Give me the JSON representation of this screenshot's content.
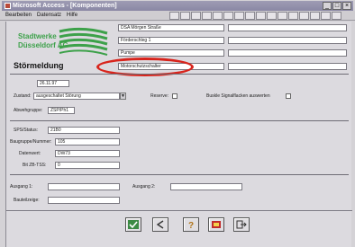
{
  "window": {
    "title": "Microsoft Access - [Komponenten]",
    "controls": [
      "_",
      "□",
      "×"
    ]
  },
  "menu": {
    "items": [
      "Bearbeiten",
      "Datensatz",
      "Hilfe"
    ]
  },
  "logo": {
    "line1": "Stadtwerke",
    "line2": "Düsseldorf AG"
  },
  "address": {
    "line1": "DSA Mörgen Straße",
    "line2": "Förderschleg 1",
    "line3": "Pumpe",
    "line4": "Motorschutzschalter"
  },
  "heading": "Störmeldung",
  "date_value": "26.11.97",
  "fields": {
    "zustand_label": "Zustand:",
    "zustand_value": "ausgeschaltet Störung",
    "reserve_label": "Reserve:",
    "signal_label": "Buskle Signalflacken auswerten",
    "abwgruppe_label": "Abwehgruppe:",
    "abwgruppe_value": "ZSP/Ph1",
    "sps_label": "SPS/Status:",
    "sps_value": "21B0",
    "baugruppe_label": "Baugruppe/Nummer:",
    "baugruppe_value": "105",
    "datenwert_label": "Datenwert:",
    "datenwert_value": "DW73",
    "bitzeile_label": "Bit ZB-TSS:",
    "bitzeile_value": "0"
  },
  "bottom_fields": {
    "ausgang1_label": "Ausgang 1:",
    "ausgang2_label": "Ausgang 2:",
    "bauteil_label": "Bauteilzeige:"
  },
  "buttons": [
    {
      "icon": "check-icon"
    },
    {
      "icon": "back-icon"
    },
    {
      "icon": "help-icon"
    },
    {
      "icon": "print-icon"
    },
    {
      "icon": "exit-icon"
    }
  ],
  "colors": {
    "logo_green": "#3da14a",
    "highlight_red": "#d8241c",
    "titlebar": "#9e9cb4"
  }
}
